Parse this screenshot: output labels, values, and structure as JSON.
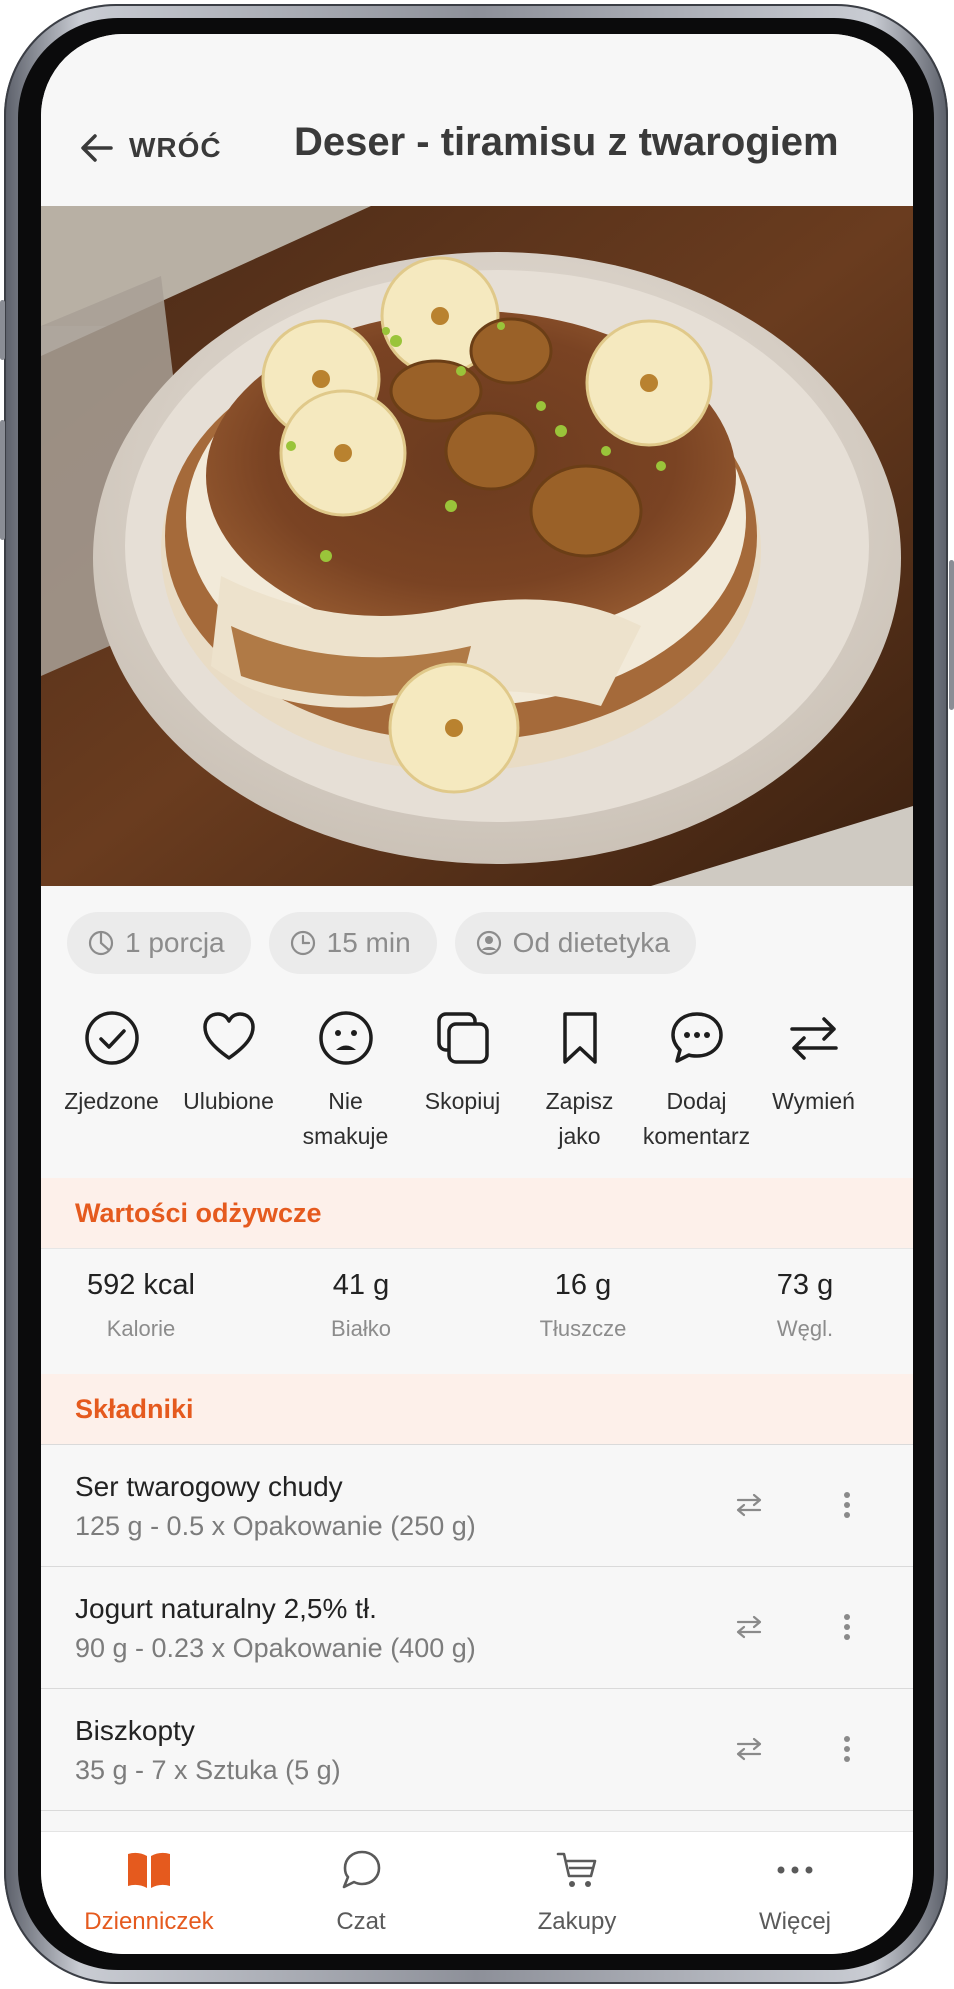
{
  "header": {
    "back_label": "WRÓĆ",
    "title": "Deser - tiramisu z twarogiem"
  },
  "photo": {
    "alt": "tiramisu"
  },
  "tags": [
    {
      "icon": "pie-icon",
      "label": "1 porcja"
    },
    {
      "icon": "clock-icon",
      "label": "15 min"
    },
    {
      "icon": "user-circle-icon",
      "label": "Od dietetyka"
    }
  ],
  "actions": [
    {
      "icon": "check-circle-icon",
      "label": "Zjedzone"
    },
    {
      "icon": "heart-icon",
      "label": "Ulubione"
    },
    {
      "icon": "sad-face-icon",
      "label": "Nie\nsmakuje"
    },
    {
      "icon": "copy-icon",
      "label": "Skopiuj"
    },
    {
      "icon": "bookmark-icon",
      "label": "Zapisz\njako"
    },
    {
      "icon": "comment-icon",
      "label": "Dodaj\nkomentarz"
    },
    {
      "icon": "swap-icon",
      "label": "Wymień"
    }
  ],
  "nutrition": {
    "heading": "Wartości odżywcze",
    "items": [
      {
        "value": "592 kcal",
        "label": "Kalorie"
      },
      {
        "value": "41 g",
        "label": "Białko"
      },
      {
        "value": "16 g",
        "label": "Tłuszcze"
      },
      {
        "value": "73 g",
        "label": "Węgl."
      }
    ]
  },
  "ingredients": {
    "heading": "Składniki",
    "items": [
      {
        "name": "Ser twarogowy chudy",
        "amount": "125 g - 0.5 x Opakowanie (250 g)"
      },
      {
        "name": "Jogurt naturalny 2,5% tł.",
        "amount": "90 g - 0.23 x Opakowanie (400 g)"
      },
      {
        "name": "Biszkopty",
        "amount": "35 g - 7 x Sztuka (5 g)"
      }
    ]
  },
  "bottom_nav": [
    {
      "icon": "book-icon",
      "label": "Dzienniczek",
      "active": true
    },
    {
      "icon": "chat-icon",
      "label": "Czat",
      "active": false
    },
    {
      "icon": "cart-icon",
      "label": "Zakupy",
      "active": false
    },
    {
      "icon": "more-icon",
      "label": "Więcej",
      "active": false
    }
  ],
  "colors": {
    "accent": "#e55a1e",
    "section_bg": "#fdf0ea",
    "text": "#222222",
    "muted": "#8c8c8c"
  }
}
